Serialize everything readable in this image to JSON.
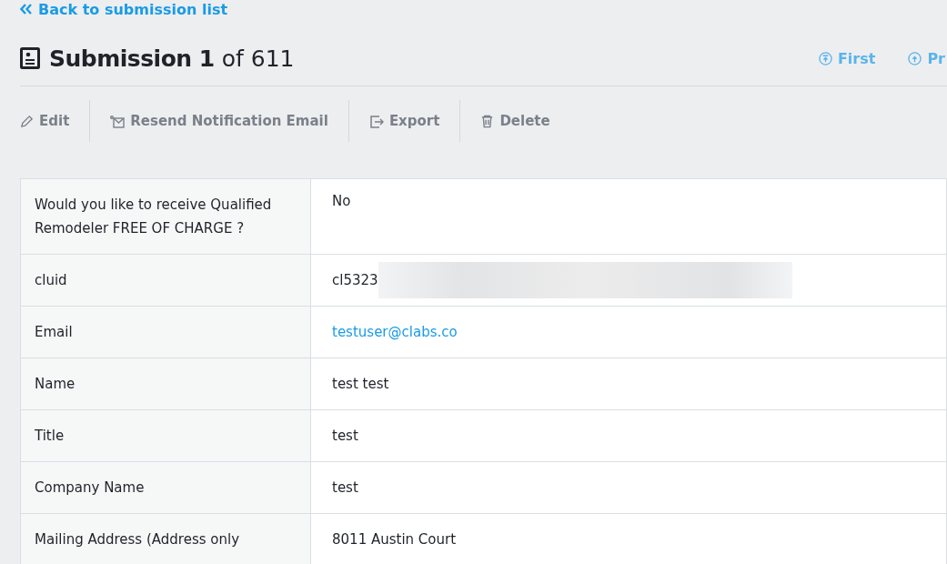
{
  "back_link": "Back to submission list",
  "header": {
    "title_bold": "Submission 1",
    "title_rest": "of 611",
    "nav": [
      {
        "kind": "first",
        "label": "First"
      },
      {
        "kind": "prev",
        "label": "Pr"
      }
    ]
  },
  "actions": [
    {
      "kind": "edit",
      "label": "Edit"
    },
    {
      "kind": "resend",
      "label": "Resend Notification Email"
    },
    {
      "kind": "export",
      "label": "Export"
    },
    {
      "kind": "delete",
      "label": "Delete"
    }
  ],
  "fields": [
    {
      "label": "Would you like to receive Qualified Remodeler FREE OF CHARGE ?",
      "value": "No",
      "kind": "text"
    },
    {
      "label": "cluid",
      "value": "cl5323",
      "kind": "redacted"
    },
    {
      "label": "Email",
      "value": "testuser@clabs.co",
      "kind": "link"
    },
    {
      "label": "Name",
      "value": "test test",
      "kind": "text"
    },
    {
      "label": "Title",
      "value": "test",
      "kind": "text"
    },
    {
      "label": "Company Name",
      "value": "test",
      "kind": "text"
    },
    {
      "label": "Mailing Address (Address only",
      "value": "8011 Austin Court",
      "kind": "text"
    }
  ]
}
